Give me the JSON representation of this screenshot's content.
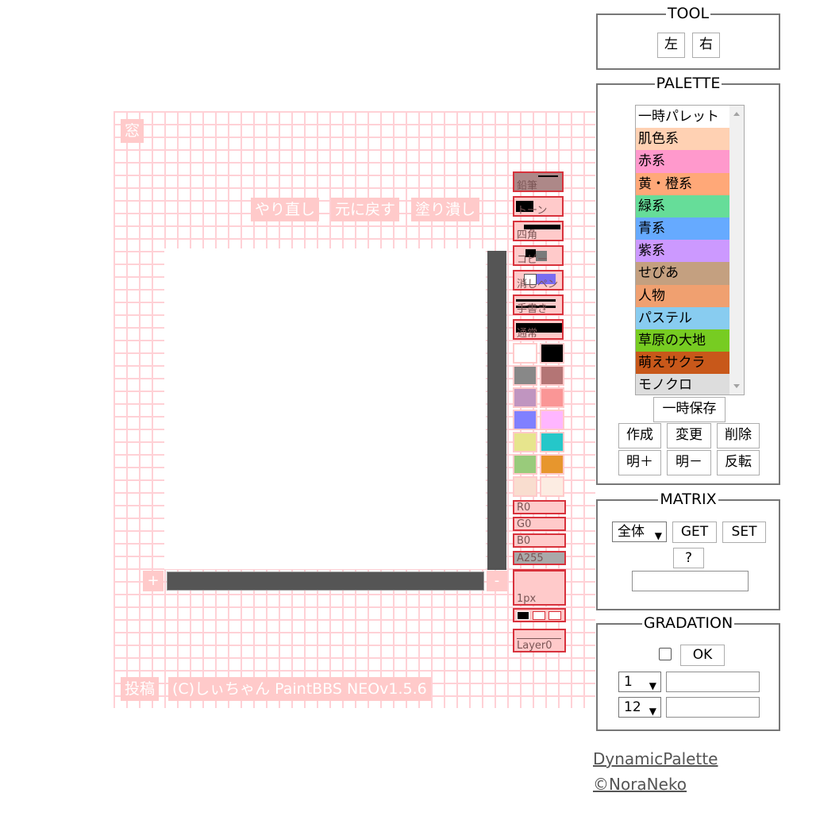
{
  "paintbbs": {
    "window_label": "窓",
    "redo_label": "やり直し",
    "undo_label": "元に戻す",
    "fill_label": "塗り潰し",
    "zoom_in_label": "+",
    "zoom_out_label": "-",
    "submit_label": "投稿",
    "credit": "(C)しぃちゃん PaintBBS NEOv1.5.6",
    "tools": [
      "鉛筆",
      "トーン",
      "四角",
      "コピー",
      "消しペン",
      "手書き",
      "通常"
    ],
    "colors": [
      "#ffffff",
      "#000000",
      "#888888",
      "#b47575",
      "#c095c0",
      "#fa9696",
      "#8080ff",
      "#ffb6ff",
      "#e7e58d",
      "#25c7c9",
      "#99cb7b",
      "#e7962d",
      "#f9ddcf",
      "#fcece2"
    ],
    "rgba": {
      "r": "R0",
      "g": "G0",
      "b": "B0",
      "a": "A255",
      "alpha_fraction": 1.0
    },
    "pen_size": "1px",
    "layer": "Layer0"
  },
  "tool_panel": {
    "legend": "TOOL",
    "left_label": "左",
    "right_label": "右"
  },
  "palette_panel": {
    "legend": "PALETTE",
    "items": [
      {
        "label": "一時パレット",
        "color": "#ffffff"
      },
      {
        "label": "肌色系",
        "color": "#ffd1b3"
      },
      {
        "label": "赤系",
        "color": "#ff99cc"
      },
      {
        "label": "黄・橙系",
        "color": "#ffa878"
      },
      {
        "label": "緑系",
        "color": "#66dd99"
      },
      {
        "label": "青系",
        "color": "#66aaff"
      },
      {
        "label": "紫系",
        "color": "#cc99ff"
      },
      {
        "label": "せぴあ",
        "color": "#c4a080"
      },
      {
        "label": "人物",
        "color": "#f0a070"
      },
      {
        "label": "パステル",
        "color": "#88ccf0"
      },
      {
        "label": "草原の大地",
        "color": "#77cc22"
      },
      {
        "label": "萌えサクラ",
        "color": "#c8581a"
      },
      {
        "label": "モノクロ",
        "color": "#dddddd"
      }
    ],
    "save_label": "一時保存",
    "create_label": "作成",
    "change_label": "変更",
    "delete_label": "削除",
    "bright_plus_label": "明＋",
    "bright_minus_label": "明－",
    "invert_label": "反転"
  },
  "matrix_panel": {
    "legend": "MATRIX",
    "select_value": "全体",
    "get_label": "GET",
    "set_label": "SET",
    "help_label": "?"
  },
  "gradation_panel": {
    "legend": "GRADATION",
    "ok_label": "OK",
    "select1_value": "1",
    "select2_value": "12"
  },
  "links": {
    "dynamic_palette": "DynamicPalette",
    "noraneko": "©NoraNeko"
  }
}
